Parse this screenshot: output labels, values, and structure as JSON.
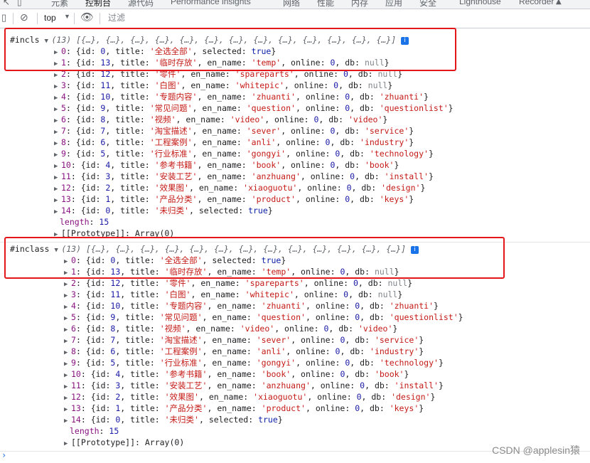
{
  "devtools": {
    "tabs": [
      "元素",
      "控制台",
      "源代码",
      "Performance insights",
      "网络",
      "性能",
      "内存",
      "应用",
      "安全",
      "Lighthouse",
      "Recorder"
    ],
    "active_tab": "控制台"
  },
  "console_toolbar": {
    "context": "top",
    "filter_placeholder": "过滤"
  },
  "groups": [
    {
      "label": "#incls",
      "count": "(13)",
      "preview": "[{…}, {…}, {…}, {…}, {…}, {…}, {…}, {…}, {…}, {…}, {…}, {…}, {…}]",
      "items": [
        {
          "idx": "0",
          "id": "0",
          "title": "'全选全部'",
          "selected": "true"
        },
        {
          "idx": "1",
          "id": "13",
          "title": "'临时存放'",
          "en_name": "'temp'",
          "online": "0",
          "db": "null"
        },
        {
          "idx": "2",
          "id": "12",
          "title": "'零件'",
          "en_name": "'spareparts'",
          "online": "0",
          "db": "null"
        },
        {
          "idx": "3",
          "id": "11",
          "title": "'白图'",
          "en_name": "'whitepic'",
          "online": "0",
          "db": "null"
        },
        {
          "idx": "4",
          "id": "10",
          "title": "'专题内容'",
          "en_name": "'zhuanti'",
          "online": "0",
          "db": "'zhuanti'"
        },
        {
          "idx": "5",
          "id": "9",
          "title": "'常见问题'",
          "en_name": "'question'",
          "online": "0",
          "db": "'questionlist'"
        },
        {
          "idx": "6",
          "id": "8",
          "title": "'视频'",
          "en_name": "'video'",
          "online": "0",
          "db": "'video'"
        },
        {
          "idx": "7",
          "id": "7",
          "title": "'淘宝描述'",
          "en_name": "'sever'",
          "online": "0",
          "db": "'service'"
        },
        {
          "idx": "8",
          "id": "6",
          "title": "'工程案例'",
          "en_name": "'anli'",
          "online": "0",
          "db": "'industry'"
        },
        {
          "idx": "9",
          "id": "5",
          "title": "'行业标准'",
          "en_name": "'gongyi'",
          "online": "0",
          "db": "'technology'"
        },
        {
          "idx": "10",
          "id": "4",
          "title": "'参考书籍'",
          "en_name": "'book'",
          "online": "0",
          "db": "'book'"
        },
        {
          "idx": "11",
          "id": "3",
          "title": "'安装工艺'",
          "en_name": "'anzhuang'",
          "online": "0",
          "db": "'install'"
        },
        {
          "idx": "12",
          "id": "2",
          "title": "'效果图'",
          "en_name": "'xiaoguotu'",
          "online": "0",
          "db": "'design'"
        },
        {
          "idx": "13",
          "id": "1",
          "title": "'产品分类'",
          "en_name": "'product'",
          "online": "0",
          "db": "'keys'"
        },
        {
          "idx": "14",
          "id": "0",
          "title": "'未归类'",
          "selected": "true"
        }
      ],
      "length_label": "length",
      "length_value": "15",
      "prototype": "[[Prototype]]: Array(0)"
    },
    {
      "label": "#inclass",
      "count": "(13)",
      "preview": "[{…}, {…}, {…}, {…}, {…}, {…}, {…}, {…}, {…}, {…}, {…}, {…}, {…}]",
      "items": [
        {
          "idx": "0",
          "id": "0",
          "title": "'全选全部'",
          "selected": "true"
        },
        {
          "idx": "1",
          "id": "13",
          "title": "'临时存放'",
          "en_name": "'temp'",
          "online": "0",
          "db": "null"
        },
        {
          "idx": "2",
          "id": "12",
          "title": "'零件'",
          "en_name": "'spareparts'",
          "online": "0",
          "db": "null"
        },
        {
          "idx": "3",
          "id": "11",
          "title": "'白图'",
          "en_name": "'whitepic'",
          "online": "0",
          "db": "null"
        },
        {
          "idx": "4",
          "id": "10",
          "title": "'专题内容'",
          "en_name": "'zhuanti'",
          "online": "0",
          "db": "'zhuanti'"
        },
        {
          "idx": "5",
          "id": "9",
          "title": "'常见问题'",
          "en_name": "'question'",
          "online": "0",
          "db": "'questionlist'"
        },
        {
          "idx": "6",
          "id": "8",
          "title": "'视频'",
          "en_name": "'video'",
          "online": "0",
          "db": "'video'"
        },
        {
          "idx": "7",
          "id": "7",
          "title": "'淘宝描述'",
          "en_name": "'sever'",
          "online": "0",
          "db": "'service'"
        },
        {
          "idx": "8",
          "id": "6",
          "title": "'工程案例'",
          "en_name": "'anli'",
          "online": "0",
          "db": "'industry'"
        },
        {
          "idx": "9",
          "id": "5",
          "title": "'行业标准'",
          "en_name": "'gongyi'",
          "online": "0",
          "db": "'technology'"
        },
        {
          "idx": "10",
          "id": "4",
          "title": "'参考书籍'",
          "en_name": "'book'",
          "online": "0",
          "db": "'book'"
        },
        {
          "idx": "11",
          "id": "3",
          "title": "'安装工艺'",
          "en_name": "'anzhuang'",
          "online": "0",
          "db": "'install'"
        },
        {
          "idx": "12",
          "id": "2",
          "title": "'效果图'",
          "en_name": "'xiaoguotu'",
          "online": "0",
          "db": "'design'"
        },
        {
          "idx": "13",
          "id": "1",
          "title": "'产品分类'",
          "en_name": "'product'",
          "online": "0",
          "db": "'keys'"
        },
        {
          "idx": "14",
          "id": "0",
          "title": "'未归类'",
          "selected": "true"
        }
      ],
      "length_label": "length",
      "length_value": "15",
      "prototype": "[[Prototype]]: Array(0)"
    }
  ],
  "watermark": "CSDN @applesin猿",
  "colors": {
    "highlight_box": "#e3161a",
    "property_key": "#881280",
    "string_value": "#c41a16",
    "number_value": "#1a1aa6"
  }
}
